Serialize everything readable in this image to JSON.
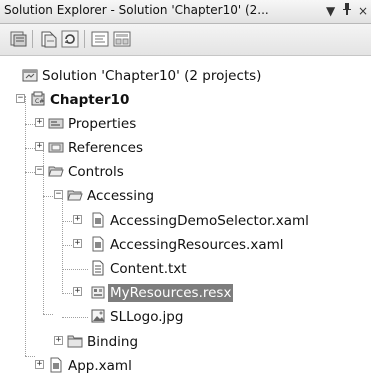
{
  "window": {
    "title": "Solution Explorer - Solution 'Chapter10' (2...",
    "dropdown_glyph": "▼",
    "pin_glyph": "ᚹ",
    "close_glyph": "×"
  },
  "tree": {
    "solution": "Solution 'Chapter10' (2 projects)",
    "project": "Chapter10",
    "properties": "Properties",
    "references": "References",
    "controls": "Controls",
    "accessing": "Accessing",
    "accessing_demo_selector": "AccessingDemoSelector.xaml",
    "accessing_resources": "AccessingResources.xaml",
    "content_txt": "Content.txt",
    "my_resources": "MyResources.resx",
    "sllogo": "SLLogo.jpg",
    "binding": "Binding",
    "app_xaml": "App.xaml"
  },
  "expanders": {
    "expanded": "−",
    "collapsed": "+"
  }
}
